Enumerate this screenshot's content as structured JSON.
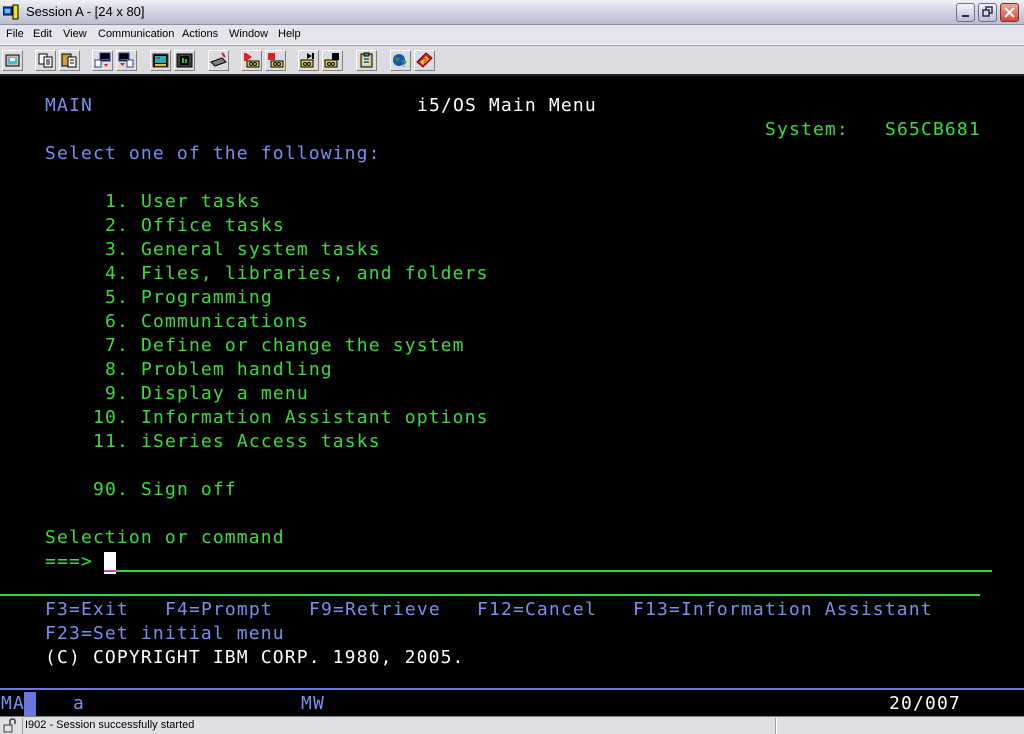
{
  "window": {
    "title": "Session A - [24 x 80]",
    "controls": [
      "minimize",
      "restore",
      "close"
    ]
  },
  "menubar": {
    "items": [
      "File",
      "Edit",
      "View",
      "Communication",
      "Actions",
      "Window",
      "Help"
    ]
  },
  "toolbar": {
    "buttons": [
      {
        "icon": "print-screen-icon"
      },
      {
        "icon": "copy-icon"
      },
      {
        "icon": "paste-icon"
      },
      {
        "icon": "send-file-to-host-icon"
      },
      {
        "icon": "receive-file-from-host-icon"
      },
      {
        "icon": "display-setup-icon"
      },
      {
        "icon": "color-map-icon"
      },
      {
        "icon": "keyboard-map-icon"
      },
      {
        "icon": "record-macro-icon"
      },
      {
        "icon": "stop-macro-icon"
      },
      {
        "icon": "play-macro-icon"
      },
      {
        "icon": "stop-playing-macro-icon"
      },
      {
        "icon": "clipboard-icon"
      },
      {
        "icon": "internet-help-icon"
      },
      {
        "icon": "help-icon"
      }
    ]
  },
  "screen": {
    "menu_id": "MAIN",
    "title": "i5/OS Main Menu",
    "system_label": "System:",
    "system_name": "S65CB681",
    "prompt": "Select one of the following:",
    "options": [
      {
        "num": " 1.",
        "label": "User tasks"
      },
      {
        "num": " 2.",
        "label": "Office tasks"
      },
      {
        "num": " 3.",
        "label": "General system tasks"
      },
      {
        "num": " 4.",
        "label": "Files, libraries, and folders"
      },
      {
        "num": " 5.",
        "label": "Programming"
      },
      {
        "num": " 6.",
        "label": "Communications"
      },
      {
        "num": " 7.",
        "label": "Define or change the system"
      },
      {
        "num": " 8.",
        "label": "Problem handling"
      },
      {
        "num": " 9.",
        "label": "Display a menu"
      },
      {
        "num": "10.",
        "label": "Information Assistant options"
      },
      {
        "num": "11.",
        "label": "iSeries Access tasks"
      },
      {
        "num": "90.",
        "label": "Sign off"
      }
    ],
    "command_label": "Selection or command",
    "command_arrow": "===>",
    "command_value": "",
    "function_keys_row1": [
      "F3=Exit",
      "F4=Prompt",
      "F9=Retrieve",
      "F12=Cancel",
      "F13=Information Assistant"
    ],
    "function_keys_row2": [
      "F23=Set initial menu"
    ],
    "copyright": "(C) COPYRIGHT IBM CORP. 1980, 2005."
  },
  "oia": {
    "mode": "MA",
    "input_indicator": "a",
    "mw": "MW",
    "cursor_position": "20/007"
  },
  "statusbar": {
    "message": "I902 - Session successfully started"
  },
  "colors": {
    "terminal_bg": "#000000",
    "field_green": "#3cdc3c",
    "label_blue": "#7890f0",
    "text_white": "#ffffff"
  }
}
